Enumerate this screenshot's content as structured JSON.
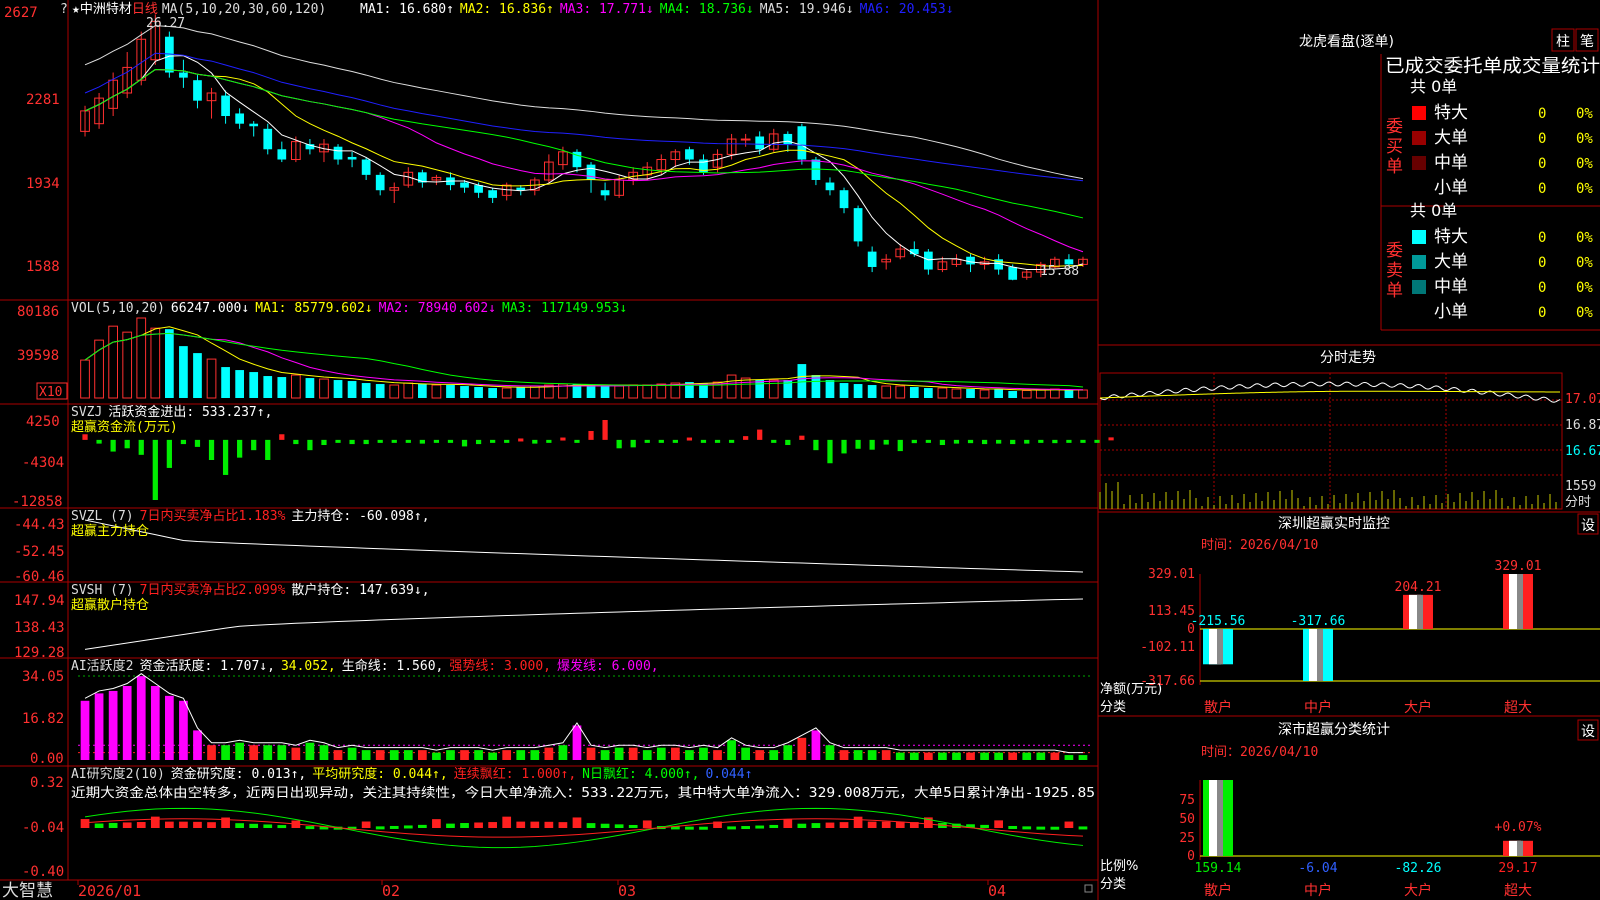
{
  "stock": {
    "name": "中洲特材",
    "period": "日线",
    "star": "★"
  },
  "brand": "大智慧",
  "price_panel": {
    "ma_text": "MA(5,10,20,30,60,120)",
    "ma_items": [
      {
        "label": "MA1: 16.680",
        "arrow": "↑",
        "color": "#ffffff"
      },
      {
        "label": "MA2: 16.836",
        "arrow": "↑",
        "color": "#ffff00"
      },
      {
        "label": "MA3: 17.771",
        "arrow": "↓",
        "color": "#ff00ff"
      },
      {
        "label": "MA4: 18.736",
        "arrow": "↓",
        "color": "#00ff00"
      },
      {
        "label": "MA5: 19.946",
        "arrow": "↓",
        "color": "#dddddd"
      },
      {
        "label": "MA6: 20.453",
        "arrow": "↓",
        "color": "#2020ff"
      }
    ],
    "y_labels": [
      "2627",
      "2281",
      "1934",
      "1588"
    ],
    "high_label": "26.27",
    "low_label": "15.88"
  },
  "vol_panel": {
    "items": [
      {
        "label": "VOL(5,10,20)",
        "color": "#dddddd"
      },
      {
        "label": "66247.000↓",
        "color": "#ffffff"
      },
      {
        "label": "MA1: 85779.602↓",
        "color": "#ffff00"
      },
      {
        "label": "MA2: 78940.602↓",
        "color": "#ff00ff"
      },
      {
        "label": "MA3: 117149.953↓",
        "color": "#00ff00"
      }
    ],
    "y_labels": [
      "80186",
      "39598"
    ],
    "unit": "X10"
  },
  "svzj_panel": {
    "items": [
      {
        "label": "SVZJ",
        "color": "#dddddd"
      },
      {
        "label": "活跃资金进出: 533.237↑,",
        "color": "#ffffff"
      }
    ],
    "subtitle": "超赢资金流(万元)",
    "y_labels": [
      "4250",
      "-4304",
      "-12858"
    ]
  },
  "svzl_panel": {
    "items": [
      {
        "label": "SVZL (7)",
        "color": "#dddddd"
      },
      {
        "label": "7日内买卖净占比1.183%",
        "color": "#ff2020"
      },
      {
        "label": "主力持仓: -60.098↑,",
        "color": "#ffffff"
      }
    ],
    "subtitle": "超赢主力持仓",
    "y_labels": [
      "-44.43",
      "-52.45",
      "-60.46"
    ]
  },
  "svsh_panel": {
    "items": [
      {
        "label": "SVSH (7)",
        "color": "#dddddd"
      },
      {
        "label": "7日内买卖净占比2.099%",
        "color": "#ff2020"
      },
      {
        "label": "散户持仓: 147.639↓,",
        "color": "#ffffff"
      }
    ],
    "subtitle": "超赢散户持仓",
    "y_labels": [
      "147.94",
      "138.43",
      "129.28"
    ]
  },
  "ai_active_panel": {
    "items": [
      {
        "label": "AI活跃度2",
        "color": "#dddddd"
      },
      {
        "label": "资金活跃度: 1.707↓,",
        "color": "#ffffff"
      },
      {
        "label": "34.052,",
        "color": "#ffff00"
      },
      {
        "label": "生命线: 1.560,",
        "color": "#ffffff"
      },
      {
        "label": "强势线: 3.000,",
        "color": "#ff2020"
      },
      {
        "label": "爆发线: 6.000,",
        "color": "#ff00ff"
      }
    ],
    "y_labels": [
      "34.05",
      "16.82",
      "0.00"
    ]
  },
  "ai_research_panel": {
    "items": [
      {
        "label": "AI研究度2(10)",
        "color": "#dddddd"
      },
      {
        "label": "资金研究度: 0.013↑,",
        "color": "#ffffff"
      },
      {
        "label": "平均研究度: 0.044↑,",
        "color": "#ffff00"
      },
      {
        "label": "连续飘红: 1.000↑,",
        "color": "#ff2020"
      },
      {
        "label": "N日飘红: 4.000↑,",
        "color": "#00ff00"
      },
      {
        "label": "0.044↑",
        "color": "#3060ff"
      }
    ],
    "summary": "近期大资金总体由空转多，近两日出现异动，关注其持续性，今日大单净流入：533.22万元，其中特大单净流入：329.008万元，大单5日累计净出-1925.85",
    "y_labels": [
      "0.32",
      "-0.04",
      "-0.40"
    ]
  },
  "x_axis": {
    "labels": [
      "2026/01",
      "02",
      "03",
      "04"
    ]
  },
  "dragon_tiger": {
    "title": "龙虎看盘(逐单)",
    "btn_bar": "柱",
    "btn_pen": "笔",
    "subtitle": "已成交委托单成交量统计",
    "buy": {
      "side_label": "委买单",
      "total": "共 0单",
      "rows": [
        {
          "name": "特大",
          "count": "0",
          "pct": "0%",
          "color": "#ff0000"
        },
        {
          "name": "大单",
          "count": "0",
          "pct": "0%",
          "color": "#990000"
        },
        {
          "name": "中单",
          "count": "0",
          "pct": "0%",
          "color": "#660000"
        },
        {
          "name": "小单",
          "count": "0",
          "pct": "0%",
          "color": ""
        }
      ]
    },
    "sell": {
      "side_label": "委卖单",
      "total": "共 0单",
      "rows": [
        {
          "name": "特大",
          "count": "0",
          "pct": "0%",
          "color": "#00ffff"
        },
        {
          "name": "大单",
          "count": "0",
          "pct": "0%",
          "color": "#009999"
        },
        {
          "name": "中单",
          "count": "0",
          "pct": "0%",
          "color": "#007777"
        },
        {
          "name": "小单",
          "count": "0",
          "pct": "0%",
          "color": ""
        }
      ]
    }
  },
  "intraday": {
    "title": "分时走势",
    "price_labels": [
      "17.07",
      "16.87",
      "16.67"
    ],
    "vol_labels": [
      "1559",
      "分时"
    ]
  },
  "sz_monitor": {
    "title": "深圳超赢实时监控",
    "set_btn": "设",
    "time_text": "时间：2026/04/10",
    "y_labels": [
      "329.01",
      "113.45",
      "0",
      "-102.11",
      "-317.66"
    ],
    "y_caption_1": "净额(万元)",
    "y_caption_2": "分类",
    "categories": [
      "散户",
      "中户",
      "大户",
      "超大"
    ],
    "values": [
      -215.56,
      -317.66,
      204.21,
      329.01
    ],
    "value_labels": [
      "-215.56",
      "-317.66",
      "204.21",
      "329.01"
    ]
  },
  "sz_category": {
    "title": "深市超赢分类统计",
    "set_btn": "设",
    "time_text": "时间：2026/04/10",
    "y_labels": [
      "75",
      "50",
      "25",
      "0"
    ],
    "y_caption_1": "比例%",
    "y_caption_2": "分类",
    "categories": [
      "散户",
      "中户",
      "大户",
      "超大"
    ],
    "pct_values": [
      100,
      0,
      0,
      20
    ],
    "value_labels": [
      "159.14",
      "-6.04",
      "-82.26",
      "29.17"
    ],
    "extra_label": "+0.07%"
  },
  "chart_data": {
    "type": "candlestick",
    "x": [
      "2026/01",
      "02",
      "03",
      "04"
    ],
    "candles": [
      [
        21.7,
        22.5,
        21.5,
        22.7
      ],
      [
        22.0,
        23.0,
        21.8,
        23.2
      ],
      [
        22.6,
        23.7,
        22.3,
        24.0
      ],
      [
        23.2,
        24.2,
        23.0,
        24.8
      ],
      [
        23.7,
        25.3,
        23.5,
        25.6
      ],
      [
        24.5,
        26.0,
        24.3,
        26.27
      ],
      [
        25.4,
        24.0,
        23.8,
        25.6
      ],
      [
        24.0,
        23.8,
        23.4,
        24.5
      ],
      [
        23.7,
        22.9,
        22.6,
        23.9
      ],
      [
        22.9,
        23.2,
        22.2,
        23.4
      ],
      [
        23.1,
        22.3,
        22.0,
        23.3
      ],
      [
        22.4,
        22.0,
        21.8,
        22.6
      ],
      [
        22.0,
        21.9,
        21.5,
        22.1
      ],
      [
        21.8,
        21.0,
        20.8,
        22.0
      ],
      [
        21.0,
        20.6,
        20.5,
        21.3
      ],
      [
        20.6,
        21.3,
        20.5,
        21.5
      ],
      [
        21.2,
        21.0,
        20.8,
        21.4
      ],
      [
        20.9,
        21.2,
        20.5,
        21.4
      ],
      [
        21.1,
        20.6,
        20.4,
        21.2
      ],
      [
        20.7,
        20.6,
        20.3,
        20.9
      ],
      [
        20.6,
        20.0,
        19.8,
        20.7
      ],
      [
        20.0,
        19.4,
        19.2,
        20.1
      ],
      [
        19.4,
        19.5,
        18.9,
        19.7
      ],
      [
        19.6,
        20.1,
        19.5,
        20.3
      ],
      [
        20.1,
        19.7,
        19.5,
        20.2
      ],
      [
        19.8,
        19.9,
        19.6,
        20.0
      ],
      [
        19.9,
        19.6,
        19.4,
        20.1
      ],
      [
        19.7,
        19.5,
        19.3,
        19.8
      ],
      [
        19.6,
        19.3,
        19.1,
        19.7
      ],
      [
        19.4,
        19.1,
        18.9,
        19.5
      ],
      [
        19.2,
        19.6,
        19.0,
        19.7
      ],
      [
        19.5,
        19.4,
        19.2,
        19.6
      ],
      [
        19.4,
        19.8,
        19.2,
        19.9
      ],
      [
        19.8,
        20.5,
        19.7,
        20.8
      ],
      [
        20.4,
        20.9,
        20.2,
        21.1
      ],
      [
        20.9,
        20.3,
        20.1,
        21.0
      ],
      [
        20.4,
        19.8,
        19.3,
        20.5
      ],
      [
        19.4,
        19.2,
        19.0,
        19.7
      ],
      [
        19.2,
        19.8,
        19.1,
        20.0
      ],
      [
        19.8,
        20.1,
        19.6,
        20.3
      ],
      [
        20.0,
        20.3,
        19.8,
        20.5
      ],
      [
        20.2,
        20.6,
        20.0,
        20.8
      ],
      [
        20.6,
        20.9,
        20.3,
        21.0
      ],
      [
        21.0,
        20.6,
        20.4,
        21.1
      ],
      [
        20.6,
        20.1,
        20.0,
        20.8
      ],
      [
        20.3,
        20.8,
        20.1,
        21.0
      ],
      [
        20.8,
        21.4,
        20.6,
        21.6
      ],
      [
        21.4,
        21.4,
        21.1,
        21.6
      ],
      [
        21.5,
        21.0,
        20.8,
        21.7
      ],
      [
        21.0,
        21.6,
        20.9,
        21.8
      ],
      [
        21.6,
        21.2,
        20.9,
        21.7
      ],
      [
        21.9,
        20.6,
        20.4,
        22.0
      ],
      [
        20.6,
        19.8,
        19.6,
        20.7
      ],
      [
        19.7,
        19.4,
        19.2,
        19.9
      ],
      [
        19.4,
        18.7,
        18.5,
        19.5
      ],
      [
        18.7,
        17.4,
        17.2,
        18.8
      ],
      [
        17.0,
        16.4,
        16.2,
        17.2
      ],
      [
        16.6,
        16.7,
        16.3,
        16.9
      ],
      [
        16.8,
        17.1,
        16.7,
        17.3
      ],
      [
        17.1,
        16.9,
        16.8,
        17.4
      ],
      [
        17.0,
        16.3,
        16.1,
        17.1
      ],
      [
        16.3,
        16.6,
        16.2,
        16.8
      ],
      [
        16.5,
        16.7,
        16.4,
        16.9
      ],
      [
        16.8,
        16.5,
        16.2,
        16.9
      ],
      [
        16.5,
        16.6,
        16.3,
        16.8
      ],
      [
        16.7,
        16.3,
        16.1,
        16.9
      ],
      [
        16.4,
        15.9,
        15.88,
        16.5
      ],
      [
        16.0,
        16.2,
        15.9,
        16.3
      ],
      [
        16.2,
        16.5,
        16.0,
        16.6
      ],
      [
        16.4,
        16.7,
        16.3,
        16.8
      ],
      [
        16.7,
        16.5,
        16.4,
        16.9
      ],
      [
        16.5,
        16.7,
        16.4,
        16.8
      ]
    ],
    "ma_series": [
      {
        "name": "MA1",
        "color": "#ffffff"
      },
      {
        "name": "MA2",
        "color": "#ffff00"
      },
      {
        "name": "MA3",
        "color": "#ff00ff"
      },
      {
        "name": "MA4",
        "color": "#00ff00"
      },
      {
        "name": "MA5",
        "color": "#dddddd"
      },
      {
        "name": "MA6",
        "color": "#2020ff"
      }
    ],
    "price_ylim": [
      15.5,
      26.6
    ],
    "volume": [
      3800,
      5800,
      7200,
      6600,
      8018,
      7000,
      6900,
      5200,
      4500,
      3900,
      3100,
      2800,
      2600,
      2200,
      2100,
      2300,
      2000,
      1900,
      1800,
      1700,
      1500,
      1400,
      1300,
      1500,
      1400,
      1300,
      1300,
      1200,
      1100,
      1000,
      1000,
      1100,
      1200,
      1300,
      1400,
      1400,
      1300,
      1200,
      1200,
      1300,
      1300,
      1400,
      1500,
      1600,
      1500,
      1600,
      2300,
      2000,
      1800,
      1800,
      1800,
      3400,
      2300,
      1800,
      1500,
      1400,
      1300,
      1200,
      1200,
      1100,
      1000,
      1000,
      900,
      900,
      800,
      900,
      700,
      750,
      800,
      900,
      850,
      800
    ],
    "svzj": [
      1200,
      -800,
      -2500,
      -1800,
      -3200,
      -12858,
      -6000,
      -900,
      -1500,
      -4304,
      -7500,
      -3800,
      -2200,
      -4300,
      1200,
      -900,
      -2200,
      -1100,
      -600,
      -900,
      -900,
      -600,
      -300,
      -300,
      -800,
      -400,
      -500,
      -1400,
      -900,
      -600,
      -300,
      300,
      -800,
      -600,
      500,
      -600,
      1900,
      4250,
      -1800,
      -1600,
      -600,
      -300,
      -400,
      500,
      -500,
      -200,
      -400,
      800,
      2200,
      -600,
      -1100,
      900,
      -2200,
      -5000,
      -2900,
      -1900,
      -2100,
      -1000,
      -2400,
      -700,
      -300,
      -1100,
      -800,
      -700,
      -900,
      -800,
      -900,
      -800,
      -400,
      -700,
      -500,
      -500,
      -400,
      533
    ],
    "svzj_ylim": [
      -12858,
      4250
    ],
    "svzl_ylim": [
      -60.46,
      -44.43
    ],
    "svsh_ylim": [
      129.28,
      147.94
    ],
    "ai_active": [
      24,
      27,
      28,
      30,
      34,
      30,
      26,
      24,
      12,
      6,
      6,
      7,
      6,
      6,
      6,
      5,
      7,
      6,
      4,
      5,
      4,
      4,
      4,
      4,
      4,
      3,
      4,
      4,
      4,
      3,
      4,
      4,
      4,
      5,
      6,
      14,
      5,
      4,
      5,
      5,
      4,
      5,
      5,
      4,
      5,
      4,
      8,
      5,
      4,
      4,
      6,
      9,
      12,
      6,
      4,
      4,
      4,
      4,
      3,
      3,
      3,
      3,
      3,
      3,
      3,
      3,
      3,
      3,
      3,
      3,
      2,
      2
    ],
    "ai_active_ylim": [
      0,
      34.05
    ],
    "ai_research_ylim": [
      -0.4,
      0.32
    ]
  }
}
